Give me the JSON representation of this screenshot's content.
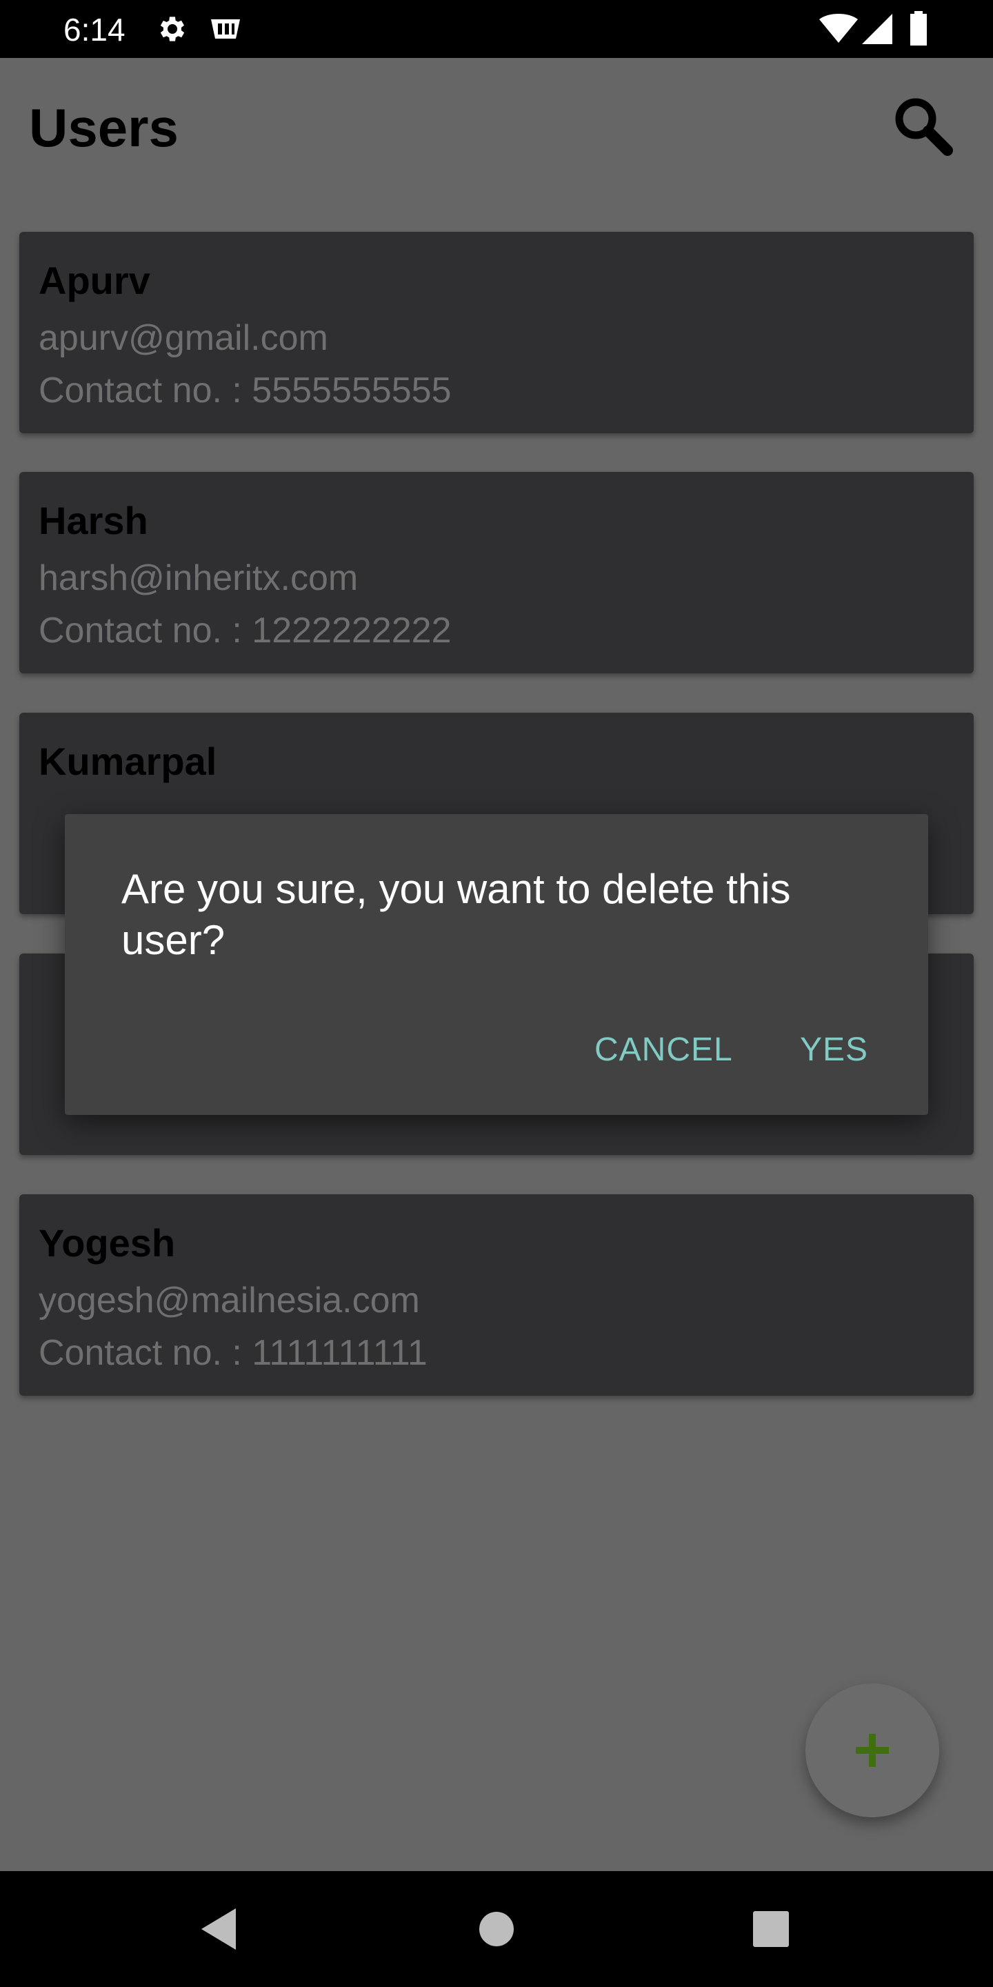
{
  "status_bar": {
    "time": "6:14",
    "icons": [
      "gear-icon",
      "app-notification-icon",
      "wifi-icon",
      "signal-icon",
      "battery-icon"
    ]
  },
  "app_bar": {
    "title": "Users",
    "search_icon": "search-icon"
  },
  "users": [
    {
      "name": "Apurv",
      "email": "apurv@gmail.com",
      "contact": "Contact no. : 5555555555"
    },
    {
      "name": "Harsh",
      "email": "harsh@inheritx.com",
      "contact": "Contact no. : 1222222222"
    },
    {
      "name": "Kumarpal",
      "email": "",
      "contact": ""
    },
    {
      "name": "",
      "email": "",
      "contact": ""
    },
    {
      "name": "Yogesh",
      "email": "yogesh@mailnesia.com",
      "contact": "Contact no. : 1111111111"
    }
  ],
  "dialog": {
    "message": "Are you sure, you want to delete this user?",
    "cancel_label": "CANCEL",
    "confirm_label": "YES"
  },
  "fab": {
    "icon": "plus-icon",
    "color": "#3f6f0f"
  },
  "nav_bar": {
    "icons": [
      "back-icon",
      "home-icon",
      "recents-icon"
    ]
  },
  "colors": {
    "scrim_background": "#666666",
    "card_background": "#2f2e30",
    "dialog_background": "#424242",
    "dialog_accent": "#80cbc4"
  }
}
